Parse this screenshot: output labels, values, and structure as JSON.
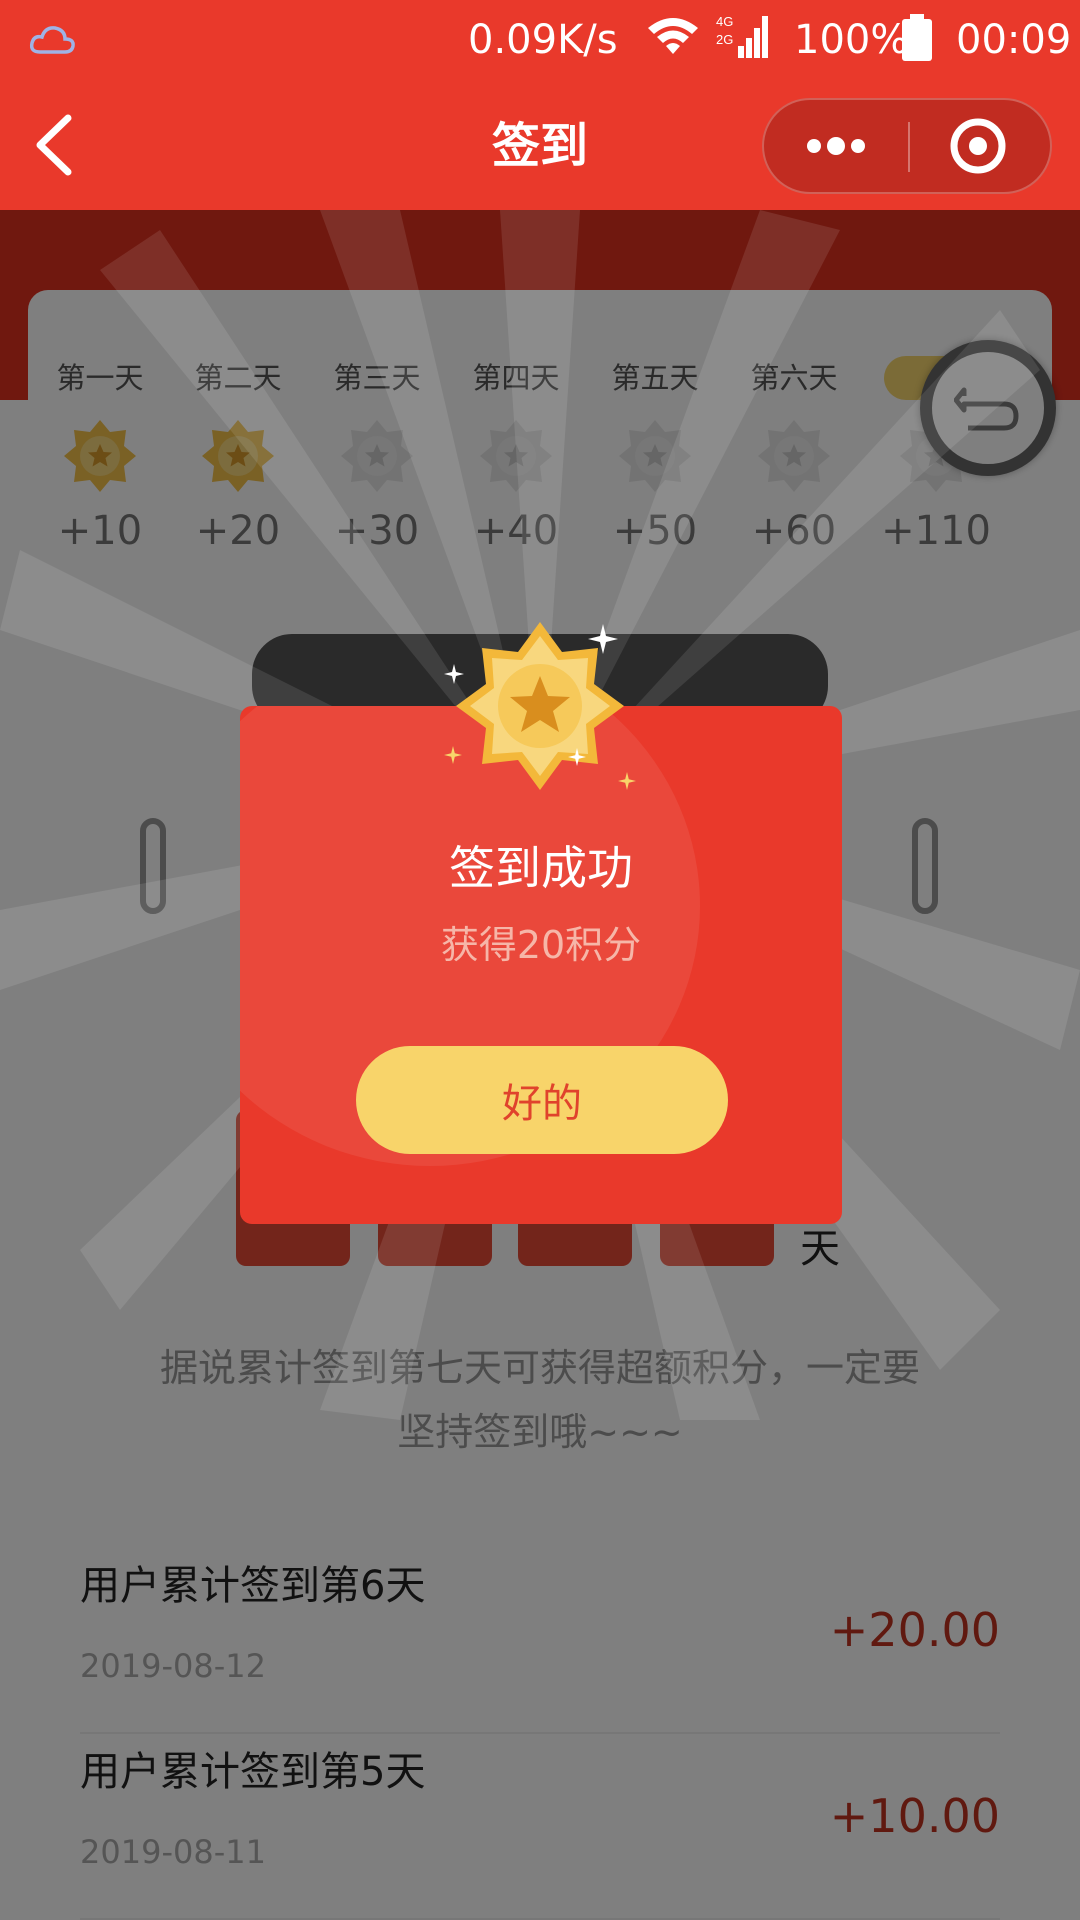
{
  "status_bar": {
    "network_speed": "0.09K/s",
    "signal_labels": [
      "4G",
      "2G"
    ],
    "battery_percent": "100%",
    "time": "00:09"
  },
  "nav": {
    "title": "签到",
    "back_icon": "chevron-left-icon",
    "more_icon": "more-dots-icon",
    "close_icon": "target-circle-icon"
  },
  "checkin_days": [
    {
      "label": "第一天",
      "points": "+10",
      "checked": true
    },
    {
      "label": "第二天",
      "points": "+20",
      "checked": true
    },
    {
      "label": "第三天",
      "points": "+30",
      "checked": false
    },
    {
      "label": "第四天",
      "points": "+40",
      "checked": false
    },
    {
      "label": "第五天",
      "points": "+50",
      "checked": false
    },
    {
      "label": "第六天",
      "points": "+60",
      "checked": false
    },
    {
      "label": "",
      "points": "+110",
      "checked": false
    }
  ],
  "calendar": {
    "unit": "天"
  },
  "tip": {
    "line1": "据说累计签到第七天可获得超额积分，一定要",
    "line2": "坚持签到哦~~~"
  },
  "records": [
    {
      "title": "用户累计签到第6天",
      "date": "2019-08-12",
      "points": "+20.00"
    },
    {
      "title": "用户累计签到第5天",
      "date": "2019-08-11",
      "points": "+10.00"
    }
  ],
  "modal": {
    "title": "签到成功",
    "subtitle": "获得20积分",
    "ok_label": "好的",
    "medal_icon": "star-medal-icon"
  },
  "colors": {
    "brand_red": "#e9392b",
    "gold": "#f8d46a",
    "points_red": "#c03220"
  }
}
